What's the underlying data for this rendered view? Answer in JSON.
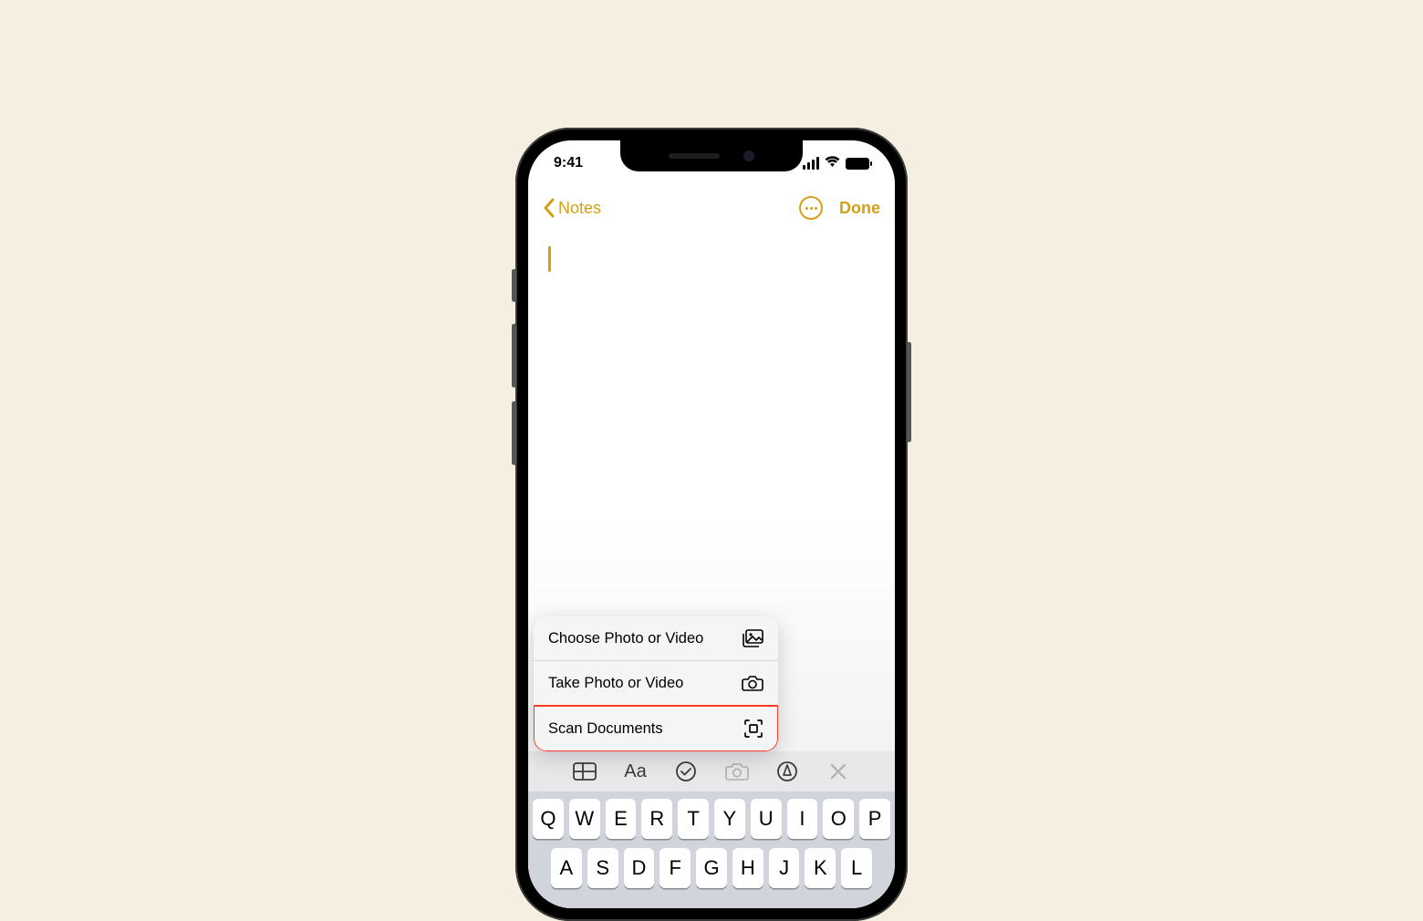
{
  "statusbar": {
    "time": "9:41"
  },
  "navbar": {
    "back_label": "Notes",
    "done_label": "Done"
  },
  "popup": {
    "choose_label": "Choose Photo or Video",
    "take_label": "Take Photo or Video",
    "scan_label": "Scan Documents"
  },
  "toolbar": {
    "aa_label": "Aa"
  },
  "keyboard": {
    "row1": [
      "Q",
      "W",
      "E",
      "R",
      "T",
      "Y",
      "U",
      "I",
      "O",
      "P"
    ],
    "row2": [
      "A",
      "S",
      "D",
      "F",
      "G",
      "H",
      "J",
      "K",
      "L"
    ]
  }
}
